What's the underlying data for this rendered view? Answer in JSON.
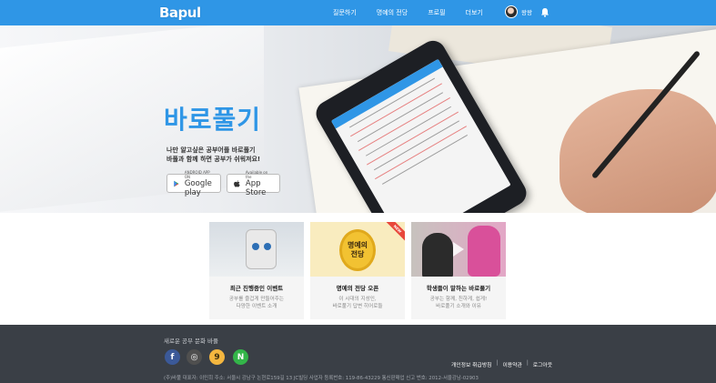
{
  "header": {
    "logo": "Bapul",
    "nav": [
      "질문하기",
      "명예의 전당",
      "프로필",
      "더보기"
    ],
    "user_name": "왕왕"
  },
  "hero": {
    "title": "바로풀기",
    "subtitle_line1": "나만 알고싶은 공부어플 바로풀기",
    "subtitle_line2": "바풀과 함께 하면 공부가 쉬워져요!",
    "google_small": "ANDROID APP ON",
    "google_big": "Google play",
    "apple_small": "Available on the",
    "apple_big": "App Store"
  },
  "cards": [
    {
      "title": "최근 진행중인 이벤트",
      "desc1": "공부를 즐겁게 만들어주는",
      "desc2": "다양한 이벤트 소개"
    },
    {
      "title": "명예의 전당 오픈",
      "desc1": "이 시대의 지성인,",
      "desc2": "바로풀기 답변 히어로들",
      "badge": "NEW",
      "image_text1": "명예의",
      "image_text2": "전당"
    },
    {
      "title": "학생들이 말하는 바로풀기",
      "desc1": "공부는 함께, 친하게, 쉽게!",
      "desc2": "바로풀기 소개와 이유"
    }
  ],
  "footer": {
    "tagline": "새로운 공부 문화 바풀",
    "social": [
      "f",
      "◎",
      "9",
      "N"
    ],
    "links": [
      "개인정보 취급방침",
      "이용약관",
      "로그아웃"
    ],
    "info": "(주)바풀  대표자: 이민희  주소: 서울시 강남구 논현로159길 13 JC빌딩  사업자 등록번호: 119-86-43229  통신판매업 신고 번호: 2012-서울강남-02903"
  },
  "colors": {
    "primary": "#2f96e6",
    "footer_bg": "#3a3f46"
  }
}
